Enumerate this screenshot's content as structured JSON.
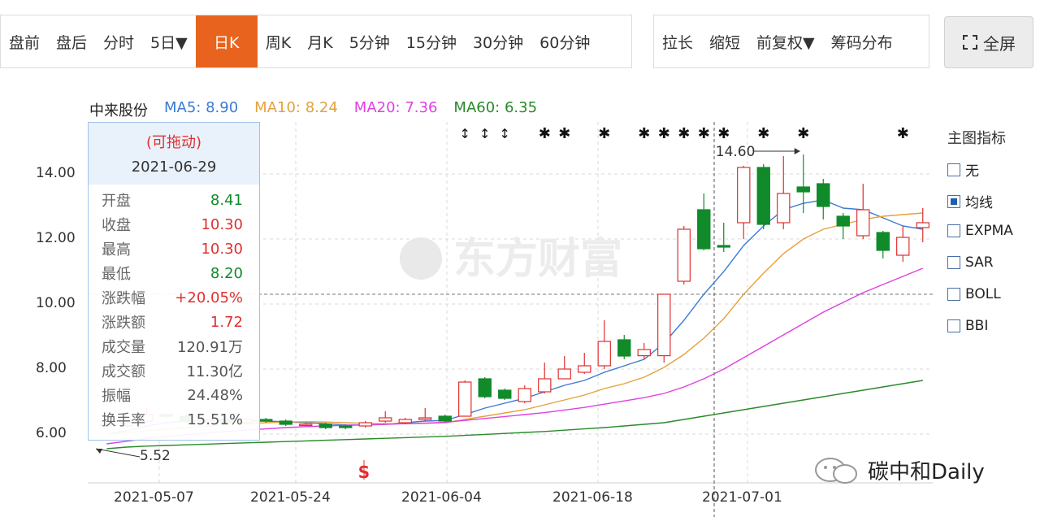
{
  "toolbar_main": [
    {
      "label": "盘前",
      "active": false
    },
    {
      "label": "盘后",
      "active": false
    },
    {
      "label": "分时",
      "active": false
    },
    {
      "label": "5日▼",
      "active": false
    },
    {
      "label": "日K",
      "active": true
    },
    {
      "label": "周K",
      "active": false
    },
    {
      "label": "月K",
      "active": false
    },
    {
      "label": "5分钟",
      "active": false
    },
    {
      "label": "15分钟",
      "active": false
    },
    {
      "label": "30分钟",
      "active": false
    },
    {
      "label": "60分钟",
      "active": false
    }
  ],
  "toolbar_tools": [
    "拉长",
    "缩短",
    "前复权▼",
    "筹码分布"
  ],
  "fullscreen_label": "全屏",
  "legend": {
    "stock_name": "中来股份",
    "ma5": "MA5: 8.90",
    "ma10": "MA10: 8.24",
    "ma20": "MA20: 7.36",
    "ma60": "MA60: 6.35"
  },
  "colors": {
    "up": "#e03030",
    "down": "#118a2a",
    "ma5": "#3a7bd5",
    "ma10": "#e3a23c",
    "ma20": "#e040e0",
    "ma60": "#2a8a2a",
    "accent": "#e8641e"
  },
  "tooltip": {
    "drag_hint": "(可拖动)",
    "date": "2021-06-29",
    "rows": [
      {
        "label": "开盘",
        "value": "8.41",
        "color": "#118a2a"
      },
      {
        "label": "收盘",
        "value": "10.30",
        "color": "#e03030"
      },
      {
        "label": "最高",
        "value": "10.30",
        "color": "#e03030"
      },
      {
        "label": "最低",
        "value": "8.20",
        "color": "#118a2a"
      },
      {
        "label": "涨跌幅",
        "value": "+20.05%",
        "color": "#e03030"
      },
      {
        "label": "涨跌额",
        "value": "1.72",
        "color": "#e03030"
      },
      {
        "label": "成交量",
        "value": "120.91万",
        "color": "#555555"
      },
      {
        "label": "成交额",
        "value": "11.30亿",
        "color": "#555555"
      },
      {
        "label": "振幅",
        "value": "24.48%",
        "color": "#555555"
      },
      {
        "label": "换手率",
        "value": "15.51%",
        "color": "#555555"
      }
    ]
  },
  "side_panel": {
    "title": "主图指标",
    "items": [
      {
        "label": "无",
        "checked": false
      },
      {
        "label": "均线",
        "checked": true
      },
      {
        "label": "EXPMA",
        "checked": false
      },
      {
        "label": "SAR",
        "checked": false
      },
      {
        "label": "BOLL",
        "checked": false
      },
      {
        "label": "BBI",
        "checked": false
      }
    ]
  },
  "watermark": "东方财富",
  "source_badge": "碳中和Daily",
  "chart_data": {
    "type": "candlestick",
    "y_ticks": [
      "14.00",
      "12.00",
      "10.00",
      "8.00",
      "6.00"
    ],
    "x_ticks": [
      "2021-05-07",
      "2021-05-24",
      "2021-06-04",
      "2021-06-18",
      "2021-07-01"
    ],
    "ylim": [
      5.4,
      15.0
    ],
    "high_marker": "14.60",
    "low_marker": "5.52",
    "reference_price": 10.3,
    "candles": [
      {
        "o": 6.3,
        "c": 6.25,
        "h": 6.35,
        "l": 6.2
      },
      {
        "o": 6.25,
        "c": 6.35,
        "h": 6.4,
        "l": 6.2
      },
      {
        "o": 6.4,
        "c": 6.6,
        "h": 6.8,
        "l": 6.35
      },
      {
        "o": 6.6,
        "c": 6.55,
        "h": 6.65,
        "l": 6.5
      },
      {
        "o": 6.55,
        "c": 6.4,
        "h": 6.6,
        "l": 6.35
      },
      {
        "o": 6.4,
        "c": 6.45,
        "h": 6.5,
        "l": 6.35
      },
      {
        "o": 6.45,
        "c": 6.35,
        "h": 6.5,
        "l": 6.3
      },
      {
        "o": 6.35,
        "c": 6.45,
        "h": 6.5,
        "l": 6.3
      },
      {
        "o": 6.45,
        "c": 6.4,
        "h": 6.5,
        "l": 6.35
      },
      {
        "o": 6.4,
        "c": 6.3,
        "h": 6.45,
        "l": 6.25
      },
      {
        "o": 6.3,
        "c": 6.3,
        "h": 6.35,
        "l": 6.25
      },
      {
        "o": 6.3,
        "c": 6.2,
        "h": 6.35,
        "l": 6.15
      },
      {
        "o": 6.25,
        "c": 6.2,
        "h": 6.3,
        "l": 6.15
      },
      {
        "o": 6.25,
        "c": 6.35,
        "h": 6.4,
        "l": 6.2
      },
      {
        "o": 6.4,
        "c": 6.5,
        "h": 6.7,
        "l": 6.35
      },
      {
        "o": 6.35,
        "c": 6.45,
        "h": 6.5,
        "l": 6.3
      },
      {
        "o": 6.45,
        "c": 6.5,
        "h": 6.8,
        "l": 6.4
      },
      {
        "o": 6.55,
        "c": 6.4,
        "h": 6.6,
        "l": 6.35
      },
      {
        "o": 6.55,
        "c": 7.6,
        "h": 7.65,
        "l": 6.55
      },
      {
        "o": 7.7,
        "c": 7.15,
        "h": 7.75,
        "l": 7.1
      },
      {
        "o": 7.35,
        "c": 7.1,
        "h": 7.4,
        "l": 7.05
      },
      {
        "o": 7.0,
        "c": 7.4,
        "h": 7.5,
        "l": 6.95
      },
      {
        "o": 7.3,
        "c": 7.7,
        "h": 8.2,
        "l": 7.25
      },
      {
        "o": 7.7,
        "c": 8.0,
        "h": 8.4,
        "l": 7.7
      },
      {
        "o": 7.9,
        "c": 8.1,
        "h": 8.5,
        "l": 7.85
      },
      {
        "o": 8.1,
        "c": 8.85,
        "h": 9.5,
        "l": 8.0
      },
      {
        "o": 8.9,
        "c": 8.4,
        "h": 9.05,
        "l": 8.3
      },
      {
        "o": 8.41,
        "c": 8.6,
        "h": 8.8,
        "l": 8.3
      },
      {
        "o": 8.41,
        "c": 10.3,
        "h": 10.3,
        "l": 8.2
      },
      {
        "o": 10.7,
        "c": 12.3,
        "h": 12.4,
        "l": 10.6
      },
      {
        "o": 12.9,
        "c": 11.7,
        "h": 13.4,
        "l": 11.65
      },
      {
        "o": 11.8,
        "c": 11.75,
        "h": 12.5,
        "l": 11.6
      },
      {
        "o": 12.5,
        "c": 14.2,
        "h": 14.25,
        "l": 12.0
      },
      {
        "o": 14.2,
        "c": 12.45,
        "h": 14.3,
        "l": 12.3
      },
      {
        "o": 12.5,
        "c": 13.4,
        "h": 14.55,
        "l": 12.3
      },
      {
        "o": 13.6,
        "c": 13.45,
        "h": 14.6,
        "l": 12.8
      },
      {
        "o": 13.7,
        "c": 13.0,
        "h": 13.85,
        "l": 12.6
      },
      {
        "o": 12.7,
        "c": 12.4,
        "h": 12.8,
        "l": 12.0
      },
      {
        "o": 12.1,
        "c": 12.9,
        "h": 13.7,
        "l": 12.0
      },
      {
        "o": 12.2,
        "c": 11.65,
        "h": 12.25,
        "l": 11.4
      },
      {
        "o": 11.5,
        "c": 12.05,
        "h": 12.4,
        "l": 11.3
      },
      {
        "o": 12.35,
        "c": 12.5,
        "h": 12.95,
        "l": 11.9
      }
    ],
    "series": [
      {
        "name": "MA5",
        "values": [
          6.0,
          6.1,
          6.25,
          6.35,
          6.4,
          6.42,
          6.4,
          6.4,
          6.4,
          6.38,
          6.35,
          6.32,
          6.28,
          6.28,
          6.3,
          6.35,
          6.4,
          6.42,
          6.6,
          6.8,
          6.95,
          7.1,
          7.3,
          7.5,
          7.65,
          7.9,
          8.1,
          8.3,
          8.8,
          9.5,
          10.3,
          11.0,
          11.8,
          12.4,
          12.9,
          13.1,
          13.2,
          12.95,
          12.9,
          12.65,
          12.4,
          12.3
        ]
      },
      {
        "name": "MA10",
        "values": [
          6.0,
          6.05,
          6.1,
          6.15,
          6.2,
          6.25,
          6.3,
          6.32,
          6.35,
          6.37,
          6.38,
          6.37,
          6.35,
          6.33,
          6.32,
          6.32,
          6.33,
          6.35,
          6.45,
          6.55,
          6.65,
          6.75,
          6.9,
          7.05,
          7.2,
          7.4,
          7.55,
          7.75,
          8.05,
          8.45,
          8.95,
          9.55,
          10.3,
          10.95,
          11.55,
          12.0,
          12.3,
          12.45,
          12.6,
          12.7,
          12.75,
          12.8
        ]
      },
      {
        "name": "MA20",
        "values": [
          5.7,
          5.78,
          5.86,
          5.92,
          5.98,
          6.03,
          6.08,
          6.12,
          6.16,
          6.2,
          6.23,
          6.25,
          6.27,
          6.28,
          6.3,
          6.32,
          6.34,
          6.36,
          6.42,
          6.48,
          6.54,
          6.6,
          6.66,
          6.74,
          6.82,
          6.92,
          7.02,
          7.12,
          7.25,
          7.45,
          7.7,
          8.0,
          8.35,
          8.7,
          9.05,
          9.4,
          9.75,
          10.05,
          10.35,
          10.6,
          10.85,
          11.1
        ]
      },
      {
        "name": "MA60",
        "values": [
          5.55,
          5.6,
          5.63,
          5.65,
          5.67,
          5.69,
          5.71,
          5.73,
          5.75,
          5.77,
          5.79,
          5.81,
          5.83,
          5.85,
          5.87,
          5.89,
          5.91,
          5.93,
          5.96,
          5.99,
          6.02,
          6.05,
          6.08,
          6.12,
          6.16,
          6.2,
          6.25,
          6.3,
          6.35,
          6.45,
          6.55,
          6.65,
          6.75,
          6.85,
          6.95,
          7.05,
          7.15,
          7.25,
          7.35,
          7.45,
          7.55,
          7.65
        ]
      }
    ]
  }
}
